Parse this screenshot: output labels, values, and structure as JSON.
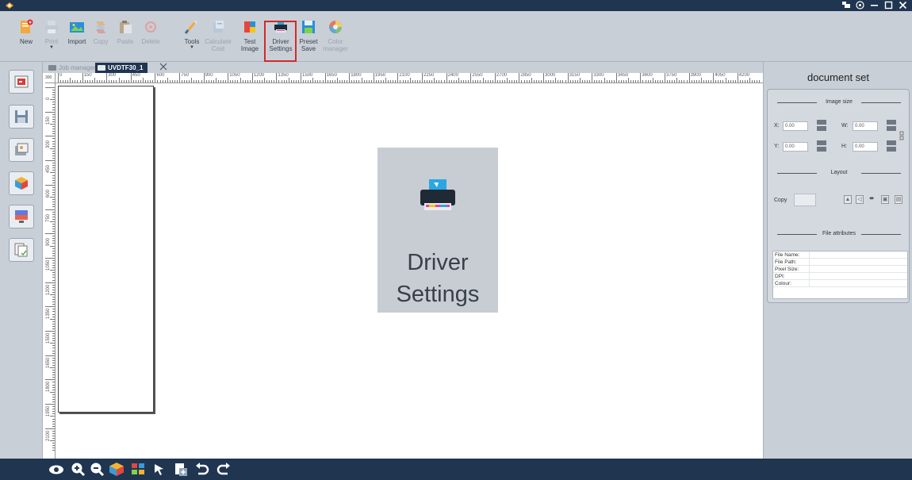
{
  "toolbar": {
    "items": [
      {
        "label": "New",
        "icon": "new-document-icon"
      },
      {
        "label": "Print",
        "icon": "print-icon"
      },
      {
        "label": "Import",
        "icon": "import-image-icon"
      },
      {
        "label": "Copy",
        "icon": "copy-icon"
      },
      {
        "label": "Paste",
        "icon": "paste-icon"
      },
      {
        "label": "Delete",
        "icon": "delete-icon"
      },
      {
        "label": "Tools",
        "icon": "tools-icon"
      },
      {
        "label": "Calculate Cost",
        "icon": "calculate-cost-icon"
      },
      {
        "label": "Test Image",
        "icon": "test-image-icon"
      },
      {
        "label": "Driver Settings",
        "icon": "driver-settings-printer-icon"
      },
      {
        "label": "Preset Save",
        "icon": "preset-save-icon"
      },
      {
        "label": "Color manager",
        "icon": "color-manager-icon"
      }
    ],
    "highlight_color": "#d22a2a"
  },
  "tabs": {
    "inactive_label": "Job manager",
    "active_label": "UVDTF30_1"
  },
  "ruler": {
    "unit_corner": "300",
    "top_labels": [
      "0",
      "150",
      "300",
      "450",
      "600",
      "750",
      "900",
      "1050",
      "1200",
      "1350",
      "1500",
      "1650",
      "1800",
      "1950",
      "2100",
      "2250",
      "2400",
      "2550",
      "2700",
      "2850",
      "3000",
      "3150",
      "3300",
      "3450",
      "3600",
      "3750",
      "3900",
      "4050",
      "4200"
    ],
    "left_labels": [
      "0",
      "150",
      "300",
      "450",
      "600",
      "750",
      "900",
      "1050",
      "1200",
      "1350",
      "1500",
      "1650",
      "1800",
      "1950",
      "2100"
    ]
  },
  "zoom_callout": {
    "line1": "Driver",
    "line2": "Settings"
  },
  "right_panel": {
    "title": "document set",
    "image_size_heading": "Image size",
    "x_label": "X:",
    "x_value": "0.00",
    "w_label": "W:",
    "w_value": "0.00",
    "y_label": "Y:",
    "y_value": "0.00",
    "h_label": "H:",
    "h_value": "0.00",
    "layout_heading": "Layout",
    "copy_label": "Copy",
    "file_attributes_heading": "File attributes",
    "attributes": [
      {
        "key": "File Name:",
        "value": ""
      },
      {
        "key": "File Path:",
        "value": ""
      },
      {
        "key": "Pixel Size:",
        "value": ""
      },
      {
        "key": "DPI:",
        "value": ""
      },
      {
        "key": "Colour:",
        "value": ""
      }
    ]
  },
  "colors": {
    "titlebar": "#1f3550",
    "toolbar": "#c9cfd7",
    "accent_red": "#d22a2a"
  }
}
